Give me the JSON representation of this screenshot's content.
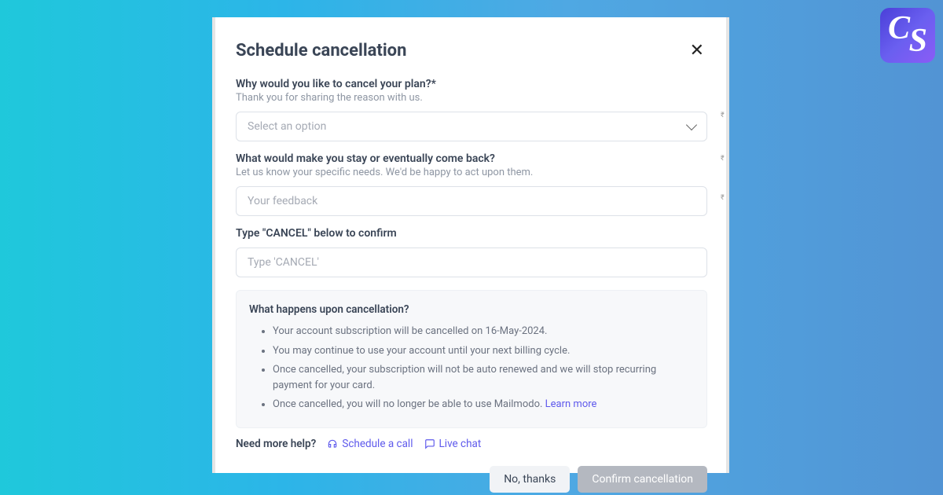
{
  "logo": {
    "letter1": "C",
    "letter2": "S"
  },
  "modal": {
    "title": "Schedule cancellation",
    "close_symbol": "✕",
    "reason": {
      "label": "Why would you like to cancel your plan?*",
      "sublabel": "Thank you for sharing the reason with us.",
      "placeholder": "Select an option"
    },
    "stay": {
      "label": "What would make you stay or eventually come back?",
      "sublabel": "Let us know your specific needs. We'd be happy to act upon them.",
      "placeholder": "Your feedback"
    },
    "confirm": {
      "label": "Type \"CANCEL\" below to confirm",
      "placeholder": "Type 'CANCEL'"
    },
    "info": {
      "title": "What happens upon cancellation?",
      "items": [
        "Your account subscription will be cancelled on 16-May-2024.",
        "You may continue to use your account until your next billing cycle.",
        "Once cancelled, your subscription will not be auto renewed and we will stop recurring payment for your card.",
        "Once cancelled, you will no longer be able to use Mailmodo. "
      ],
      "learn_more": "Learn more"
    },
    "help": {
      "label": "Need more help?",
      "schedule": "Schedule a call",
      "chat": "Live chat"
    },
    "buttons": {
      "secondary": "No, thanks",
      "primary": "Confirm cancellation"
    }
  }
}
